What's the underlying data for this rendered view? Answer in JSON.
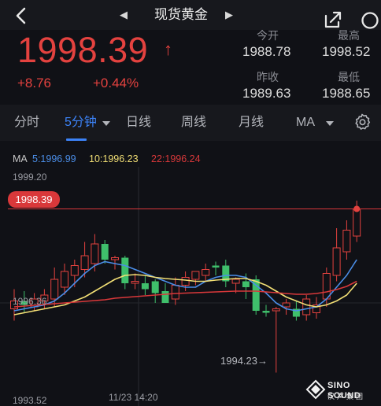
{
  "header": {
    "title": "现货黄金",
    "back_icon": "chevron-left-icon",
    "prev_icon": "triangle-left-icon",
    "next_icon": "triangle-right-icon",
    "share_icon": "share-icon",
    "search_icon": "search-icon"
  },
  "quote": {
    "price": "1998.39",
    "direction_icon": "↑",
    "change": "+8.76",
    "change_percent": "+0.44%",
    "stats": [
      {
        "label": "今开",
        "value": "1988.78"
      },
      {
        "label": "最高",
        "value": "1998.52"
      },
      {
        "label": "昨收",
        "value": "1989.63"
      },
      {
        "label": "最低",
        "value": "1988.65"
      }
    ],
    "up_color": "#e4423f"
  },
  "tabs": {
    "items": [
      "分时",
      "5分钟",
      "日线",
      "周线",
      "月线",
      "MA"
    ],
    "active": "5分钟",
    "settings_icon": "gear-icon",
    "accent_color": "#3c82f6"
  },
  "ma_legend": {
    "ma": "MA",
    "ma5": "5:1996.99",
    "ma10": "10:1996.23",
    "ma22": "22:1996.24",
    "ma5_color": "#4b8ee8",
    "ma10_color": "#f2df75",
    "ma22_color": "#d9383a"
  },
  "chart_labels": {
    "y_top": "1999.20",
    "y_mid": "1996.36",
    "y_bottom": "1993.52",
    "current_price": "1998.39",
    "x_time": "11/23 14:20",
    "low_marker": "1994.23→"
  },
  "watermark": {
    "name": "SINO SOUND",
    "sub": "汉声集团"
  },
  "chart_data": {
    "type": "candlestick",
    "interval": "5分钟",
    "ylim": [
      1993.52,
      1999.2
    ],
    "current_price": 1998.39,
    "x_label": "11/23 14:20",
    "candles": [
      {
        "o": 1995.85,
        "h": 1996.35,
        "l": 1995.55,
        "c": 1996.05
      },
      {
        "o": 1996.05,
        "h": 1996.3,
        "l": 1995.75,
        "c": 1995.95
      },
      {
        "o": 1995.9,
        "h": 1996.25,
        "l": 1995.8,
        "c": 1996.1
      },
      {
        "o": 1996.05,
        "h": 1996.35,
        "l": 1995.85,
        "c": 1996.2
      },
      {
        "o": 1996.1,
        "h": 1996.9,
        "l": 1995.9,
        "c": 1996.6
      },
      {
        "o": 1996.4,
        "h": 1997.0,
        "l": 1996.2,
        "c": 1996.8
      },
      {
        "o": 1996.7,
        "h": 1997.1,
        "l": 1996.4,
        "c": 1996.95
      },
      {
        "o": 1996.85,
        "h": 1997.55,
        "l": 1996.65,
        "c": 1997.2
      },
      {
        "o": 1997.0,
        "h": 1997.75,
        "l": 1996.8,
        "c": 1997.5
      },
      {
        "o": 1997.5,
        "h": 1997.6,
        "l": 1997.0,
        "c": 1997.1
      },
      {
        "o": 1997.1,
        "h": 1997.2,
        "l": 1996.85,
        "c": 1997.15
      },
      {
        "o": 1997.15,
        "h": 1997.2,
        "l": 1996.35,
        "c": 1996.5
      },
      {
        "o": 1996.5,
        "h": 1996.75,
        "l": 1996.35,
        "c": 1996.55
      },
      {
        "o": 1996.5,
        "h": 1996.7,
        "l": 1996.2,
        "c": 1996.35
      },
      {
        "o": 1996.55,
        "h": 1996.6,
        "l": 1996.0,
        "c": 1996.25
      },
      {
        "o": 1996.3,
        "h": 1996.5,
        "l": 1996.05,
        "c": 1996.0
      },
      {
        "o": 1996.1,
        "h": 1996.65,
        "l": 1995.95,
        "c": 1996.45
      },
      {
        "o": 1996.45,
        "h": 1996.8,
        "l": 1996.3,
        "c": 1996.65
      },
      {
        "o": 1996.6,
        "h": 1996.75,
        "l": 1996.45,
        "c": 1996.8
      },
      {
        "o": 1996.7,
        "h": 1997.0,
        "l": 1996.55,
        "c": 1996.85
      },
      {
        "o": 1996.95,
        "h": 1997.05,
        "l": 1996.7,
        "c": 1996.9
      },
      {
        "o": 1996.95,
        "h": 1997.1,
        "l": 1996.4,
        "c": 1996.55
      },
      {
        "o": 1996.5,
        "h": 1996.65,
        "l": 1996.25,
        "c": 1996.6
      },
      {
        "o": 1996.55,
        "h": 1996.75,
        "l": 1996.1,
        "c": 1996.4
      },
      {
        "o": 1996.6,
        "h": 1996.7,
        "l": 1995.7,
        "c": 1995.8
      },
      {
        "o": 1995.8,
        "h": 1995.95,
        "l": 1995.65,
        "c": 1995.75
      },
      {
        "o": 1995.8,
        "h": 1995.9,
        "l": 1994.23,
        "c": 1995.85
      },
      {
        "o": 1995.9,
        "h": 1996.1,
        "l": 1995.7,
        "c": 1996.0
      },
      {
        "o": 1995.85,
        "h": 1996.05,
        "l": 1995.55,
        "c": 1995.65
      },
      {
        "o": 1995.7,
        "h": 1996.2,
        "l": 1995.55,
        "c": 1996.1
      },
      {
        "o": 1995.75,
        "h": 1996.15,
        "l": 1995.6,
        "c": 1995.95
      },
      {
        "o": 1996.1,
        "h": 1996.9,
        "l": 1995.9,
        "c": 1996.75
      },
      {
        "o": 1996.7,
        "h": 1997.9,
        "l": 1996.55,
        "c": 1997.4
      },
      {
        "o": 1997.3,
        "h": 1998.1,
        "l": 1997.1,
        "c": 1997.85
      },
      {
        "o": 1997.7,
        "h": 1998.6,
        "l": 1997.55,
        "c": 1998.39
      }
    ],
    "series": [
      {
        "name": "MA5",
        "values": [
          1995.8,
          1995.85,
          1995.9,
          1995.95,
          1996.05,
          1996.25,
          1996.5,
          1996.75,
          1996.95,
          1997.05,
          1997.0,
          1996.95,
          1996.85,
          1996.75,
          1996.65,
          1996.55,
          1996.45,
          1996.4,
          1996.4,
          1996.55,
          1996.65,
          1996.7,
          1996.7,
          1996.65,
          1996.45,
          1996.25,
          1996.0,
          1995.85,
          1995.8,
          1995.85,
          1995.9,
          1996.1,
          1996.4,
          1996.7,
          1997.1
        ]
      },
      {
        "name": "MA10",
        "values": [
          1995.7,
          1995.75,
          1995.8,
          1995.85,
          1995.9,
          1995.95,
          1996.05,
          1996.15,
          1996.3,
          1996.45,
          1996.6,
          1996.7,
          1996.72,
          1996.7,
          1996.65,
          1996.62,
          1996.6,
          1996.58,
          1996.55,
          1996.55,
          1996.58,
          1996.6,
          1996.62,
          1996.62,
          1996.55,
          1996.45,
          1996.3,
          1996.15,
          1996.05,
          1995.95,
          1995.9,
          1995.95,
          1996.05,
          1996.2,
          1996.5
        ]
      },
      {
        "name": "MA22",
        "values": [
          1995.9,
          1995.92,
          1995.94,
          1995.96,
          1995.98,
          1996.0,
          1996.02,
          1996.04,
          1996.06,
          1996.08,
          1996.12,
          1996.14,
          1996.16,
          1996.18,
          1996.2,
          1996.22,
          1996.24,
          1996.25,
          1996.26,
          1996.27,
          1996.28,
          1996.29,
          1996.3,
          1996.3,
          1996.3,
          1996.28,
          1996.26,
          1996.24,
          1996.22,
          1996.22,
          1996.24,
          1996.28,
          1996.34,
          1996.42,
          1996.55
        ]
      }
    ]
  }
}
